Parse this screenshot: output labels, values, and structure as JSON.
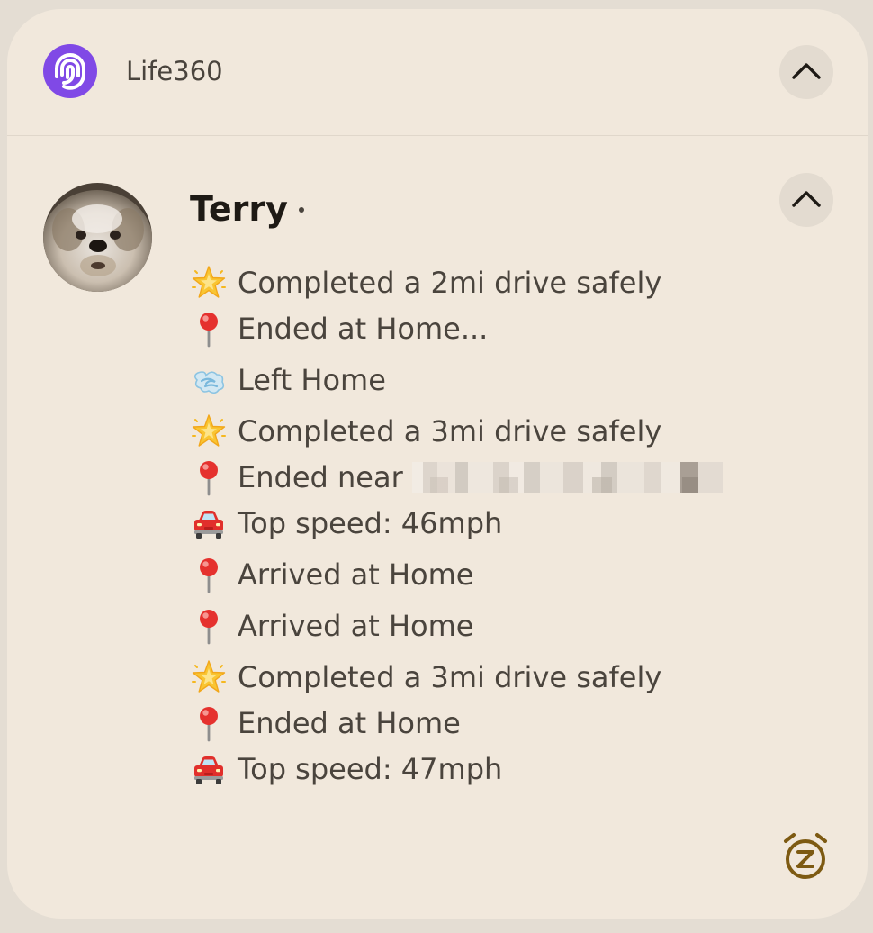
{
  "notification": {
    "app_name": "Life360",
    "app_icon": "life360-logo-icon",
    "collapse_icon": "chevron-up-icon",
    "snooze_icon": "snooze-alarm-icon",
    "sender": "Terry",
    "avatar": "dog-avatar",
    "messages": [
      [
        {
          "emoji": "glowing-star",
          "text": "Completed a 2mi drive safely"
        },
        {
          "emoji": "round-pushpin",
          "text": "Ended at Home..."
        }
      ],
      [
        {
          "emoji": "dashing-away",
          "text": "Left Home"
        }
      ],
      [
        {
          "emoji": "glowing-star",
          "text": "Completed a 3mi drive safely"
        },
        {
          "emoji": "round-pushpin",
          "text": "Ended near",
          "redacted": true
        },
        {
          "emoji": "automobile",
          "text": "Top speed: 46mph"
        }
      ],
      [
        {
          "emoji": "round-pushpin",
          "text": "Arrived at Home"
        }
      ],
      [
        {
          "emoji": "round-pushpin",
          "text": "Arrived at Home"
        }
      ],
      [
        {
          "emoji": "glowing-star",
          "text": "Completed a 3mi drive safely"
        },
        {
          "emoji": "round-pushpin",
          "text": "Ended at Home"
        },
        {
          "emoji": "automobile",
          "text": "Top speed: 47mph"
        }
      ]
    ]
  },
  "colors": {
    "card_background": "#f1e8dc",
    "app_accent": "#8049e6",
    "button_background": "#e3dbd0",
    "snooze": "#7d5a12"
  }
}
